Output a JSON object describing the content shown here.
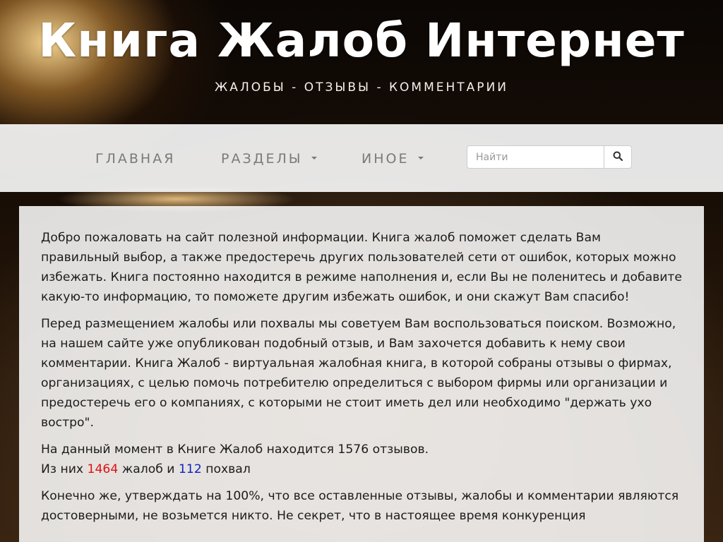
{
  "header": {
    "title": "Книга Жалоб Интернет",
    "tagline": "ЖАЛОБЫ - ОТЗЫВЫ - КОММЕНТАРИИ"
  },
  "nav": {
    "home": "ГЛАВНАЯ",
    "sections": "РАЗДЕЛЫ",
    "other": "ИНОЕ"
  },
  "search": {
    "placeholder": "Найти",
    "value": ""
  },
  "icons": {
    "search_button": "search-icon",
    "dropdown": "caret-down-icon"
  },
  "content": {
    "p1": "Добро пожаловать на сайт полезной информации. Книга жалоб поможет сделать Вам правильный выбор, а также предостеречь других пользователей сети от ошибок, которых можно избежать. Книга постоянно находится в режиме наполнения и, если Вы не поленитесь и добавите какую-то информацию, то поможете другим избежать ошибок, и они скажут Вам спасибо!",
    "p2": "Перед размещением жалобы или похвалы мы советуем Вам воспользоваться поиском. Возможно, на нашем сайте уже опубликован подобный отзыв, и Вам захочется добавить к нему свои комментарии. Книга Жалоб - виртуальная жалобная книга, в которой собраны отзывы о фирмах, организациях, с целью помочь потребителю определиться с выбором фирмы или организации и предостеречь его о компаниях, с которыми не стоит иметь дел или необходимо \"держать ухо востро\".",
    "stats": {
      "line1_prefix": "На данный момент в Книге Жалоб находится ",
      "total": "1576",
      "line1_suffix": " отзывов.",
      "line2_prefix": "Из них ",
      "complaints": "1464",
      "line2_middle": " жалоб и ",
      "praises": "112",
      "line2_suffix": " похвал"
    },
    "p4": "Конечно же, утверждать на 100%, что все оставленные отзывы, жалобы и комментарии являются достоверными, не возьмется никто. Не секрет, что в настоящее время конкуренция"
  },
  "colors": {
    "complaints": "#e01010",
    "praises": "#1020c0",
    "nav_text": "#7a7a7a"
  }
}
